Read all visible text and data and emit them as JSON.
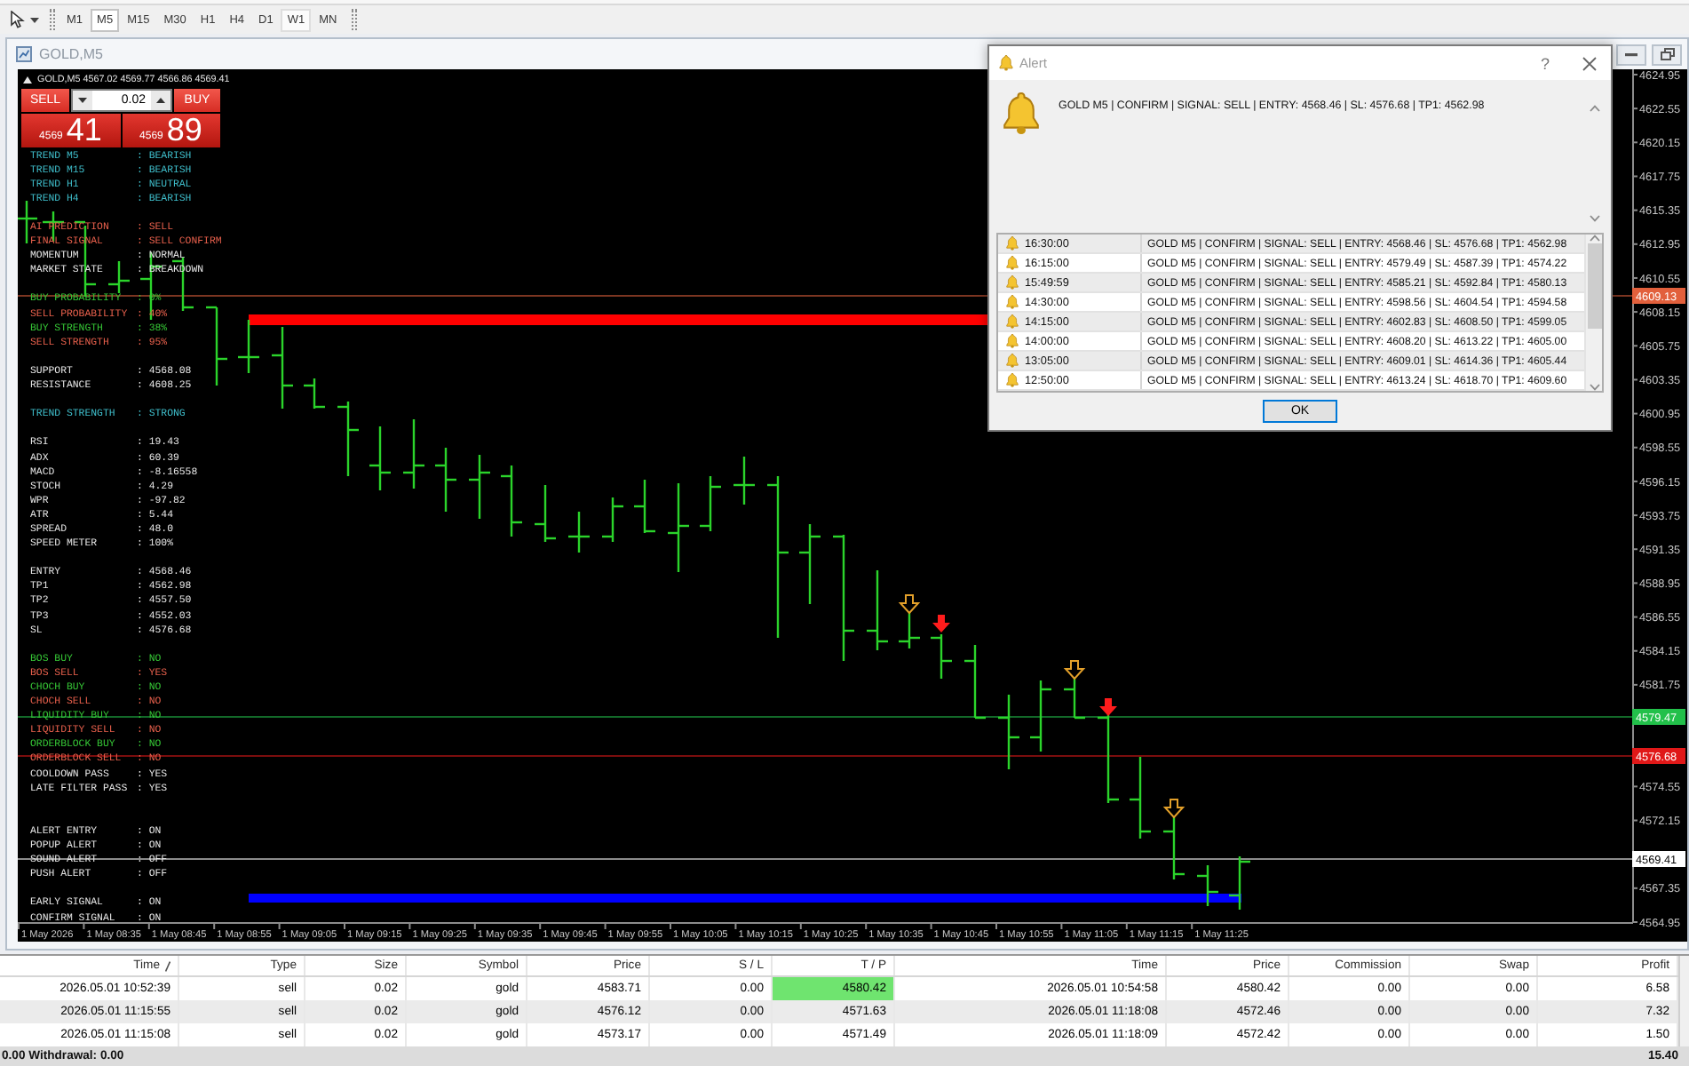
{
  "toolbar": {
    "timeframes": [
      {
        "label": "M1",
        "selected": false,
        "hovered": false
      },
      {
        "label": "M5",
        "selected": true,
        "hovered": false
      },
      {
        "label": "M15",
        "selected": false,
        "hovered": false
      },
      {
        "label": "M30",
        "selected": false,
        "hovered": false
      },
      {
        "label": "H1",
        "selected": false,
        "hovered": false
      },
      {
        "label": "H4",
        "selected": false,
        "hovered": false
      },
      {
        "label": "D1",
        "selected": false,
        "hovered": false
      },
      {
        "label": "W1",
        "selected": false,
        "hovered": true
      },
      {
        "label": "MN",
        "selected": false,
        "hovered": false
      }
    ]
  },
  "chart_window": {
    "title": "GOLD,M5"
  },
  "chart": {
    "header": "GOLD,M5 4567.02 4569.77 4566.86 4569.41",
    "trade_panel": {
      "sell": "SELL",
      "buy": "BUY",
      "lot": "0.02",
      "sell_price": {
        "prefix": "4569",
        "main": "41"
      },
      "buy_price": {
        "prefix": "4569",
        "main": "89"
      }
    },
    "info_sections": [
      {
        "rows": [
          {
            "label": "TREND M5",
            "value": ": BEARISH",
            "color": "#3fbfcc"
          },
          {
            "label": "TREND M15",
            "value": ": BEARISH",
            "color": "#3fbfcc"
          },
          {
            "label": "TREND H1",
            "value": ": NEUTRAL",
            "color": "#3fbfcc"
          },
          {
            "label": "TREND H4",
            "value": ": BEARISH",
            "color": "#3fbfcc"
          }
        ]
      },
      {
        "rows": [
          {
            "label": "AI PREDICTION",
            "value": ": SELL",
            "color": "#e8604c"
          },
          {
            "label": "FINAL SIGNAL",
            "value": ": SELL CONFIRM",
            "color": "#e8604c"
          },
          {
            "label": "MOMENTUM",
            "value": ": NORMAL",
            "color": "#e6e6e6"
          },
          {
            "label": "MARKET STATE",
            "value": ": BREAKDOWN",
            "color": "#e6e6e6"
          }
        ]
      },
      {
        "rows": [
          {
            "label": "BUY PROBABILITY",
            "value": ": 0%",
            "color": "#36c836"
          },
          {
            "label": "SELL PROBABILITY",
            "value": ": 40%",
            "color": "#e8604c"
          },
          {
            "label": "BUY STRENGTH",
            "value": ": 38%",
            "color": "#36c836"
          },
          {
            "label": "SELL STRENGTH",
            "value": ": 95%",
            "color": "#e8604c"
          }
        ]
      },
      {
        "rows": [
          {
            "label": "SUPPORT",
            "value": ": 4568.08",
            "color": "#e6e6e6"
          },
          {
            "label": "RESISTANCE",
            "value": ": 4608.25",
            "color": "#e6e6e6"
          }
        ]
      },
      {
        "rows": [
          {
            "label": "TREND STRENGTH",
            "value": ": STRONG",
            "color": "#3fbfcc"
          }
        ]
      },
      {
        "rows": [
          {
            "label": "RSI",
            "value": ": 19.43",
            "color": "#e6e6e6"
          },
          {
            "label": "ADX",
            "value": ": 60.39",
            "color": "#e6e6e6"
          },
          {
            "label": "MACD",
            "value": ": -8.16558",
            "color": "#e6e6e6"
          },
          {
            "label": "STOCH",
            "value": ": 4.29",
            "color": "#e6e6e6"
          },
          {
            "label": "WPR",
            "value": ": -97.82",
            "color": "#e6e6e6"
          },
          {
            "label": "ATR",
            "value": ": 5.44",
            "color": "#e6e6e6"
          },
          {
            "label": "SPREAD",
            "value": ": 48.0",
            "color": "#e6e6e6"
          },
          {
            "label": "SPEED METER",
            "value": ": 100%",
            "color": "#e6e6e6"
          }
        ]
      },
      {
        "rows": [
          {
            "label": "ENTRY",
            "value": ": 4568.46",
            "color": "#e6e6e6"
          },
          {
            "label": "TP1",
            "value": ": 4562.98",
            "color": "#e6e6e6"
          },
          {
            "label": "TP2",
            "value": ": 4557.50",
            "color": "#e6e6e6"
          },
          {
            "label": "TP3",
            "value": ": 4552.03",
            "color": "#e6e6e6"
          },
          {
            "label": "SL",
            "value": ": 4576.68",
            "color": "#e6e6e6"
          }
        ]
      },
      {
        "rows": [
          {
            "label": "BOS BUY",
            "value": ": NO",
            "color": "#36c836"
          },
          {
            "label": "BOS SELL",
            "value": ": YES",
            "color": "#e8604c"
          },
          {
            "label": "CHOCH BUY",
            "value": ": NO",
            "color": "#36c836"
          },
          {
            "label": "CHOCH SELL",
            "value": ": NO",
            "color": "#e8604c"
          },
          {
            "label": "LIQUIDITY BUY",
            "value": ": NO",
            "color": "#36c836"
          },
          {
            "label": "LIQUIDITY SELL",
            "value": ": NO",
            "color": "#e8604c"
          },
          {
            "label": "ORDERBLOCK BUY",
            "value": ": NO",
            "color": "#36c836"
          },
          {
            "label": "ORDERBLOCK SELL",
            "value": ": NO",
            "color": "#e8604c"
          },
          {
            "label": "COOLDOWN PASS",
            "value": ": YES",
            "color": "#e6e6e6"
          },
          {
            "label": "LATE FILTER PASS",
            "value": ": YES",
            "color": "#e6e6e6"
          }
        ]
      },
      {
        "rows": [
          {
            "label": "ALERT ENTRY",
            "value": ": ON",
            "color": "#e6e6e6"
          },
          {
            "label": "POPUP ALERT",
            "value": ": ON",
            "color": "#e6e6e6"
          },
          {
            "label": "SOUND ALERT",
            "value": ": OFF",
            "color": "#e6e6e6"
          },
          {
            "label": "PUSH ALERT",
            "value": ": OFF",
            "color": "#e6e6e6"
          }
        ]
      },
      {
        "rows": [
          {
            "label": "EARLY SIGNAL",
            "value": ": ON",
            "color": "#e6e6e6"
          },
          {
            "label": "CONFIRM SIGNAL",
            "value": ": ON",
            "color": "#e6e6e6"
          }
        ]
      }
    ],
    "price_axis": [
      "4624.95",
      "4622.55",
      "4620.15",
      "4617.75",
      "4615.35",
      "4612.95",
      "4610.55",
      "4608.15",
      "4605.75",
      "4603.35",
      "4600.95",
      "4598.55",
      "4596.15",
      "4593.75",
      "4591.35",
      "4588.95",
      "4586.55",
      "4584.15",
      "4581.75",
      "4574.55",
      "4572.15",
      "4567.35",
      "4564.95"
    ],
    "price_badges": [
      {
        "text": "4609.13",
        "color": "#e2603c"
      },
      {
        "text": "4579.47",
        "color": "#22c04a"
      },
      {
        "text": "4576.68",
        "color": "#e01818"
      },
      {
        "text": "4569.41",
        "color": "#ffffff"
      }
    ],
    "time_axis": [
      "1 May 2026",
      "1 May 08:35",
      "1 May 08:45",
      "1 May 08:55",
      "1 May 09:05",
      "1 May 09:15",
      "1 May 09:25",
      "1 May 09:35",
      "1 May 09:45",
      "1 May 09:55",
      "1 May 10:05",
      "1 May 10:15",
      "1 May 10:25",
      "1 May 10:35",
      "1 May 10:45",
      "1 May 10:55",
      "1 May 11:05",
      "1 May 11:15",
      "1 May 11:25"
    ]
  },
  "alert_dialog": {
    "title": "Alert",
    "help": "?",
    "message": "GOLD M5 | CONFIRM | SIGNAL: SELL | ENTRY: 4568.46 | SL: 4576.68 | TP1: 4562.98",
    "history": [
      {
        "time": "16:30:00",
        "message": "GOLD M5 | CONFIRM | SIGNAL: SELL | ENTRY: 4568.46 | SL: 4576.68 | TP1: 4562.98"
      },
      {
        "time": "16:15:00",
        "message": "GOLD M5 | CONFIRM | SIGNAL: SELL | ENTRY: 4579.49 | SL: 4587.39 | TP1: 4574.22"
      },
      {
        "time": "15:49:59",
        "message": "GOLD M5 | CONFIRM | SIGNAL: SELL | ENTRY: 4585.21 | SL: 4592.84 | TP1: 4580.13"
      },
      {
        "time": "14:30:00",
        "message": "GOLD M5 | CONFIRM | SIGNAL: SELL | ENTRY: 4598.56 | SL: 4604.54 | TP1: 4594.58"
      },
      {
        "time": "14:15:00",
        "message": "GOLD M5 | CONFIRM | SIGNAL: SELL | ENTRY: 4602.83 | SL: 4608.50 | TP1: 4599.05"
      },
      {
        "time": "14:00:00",
        "message": "GOLD M5 | CONFIRM | SIGNAL: SELL | ENTRY: 4608.20 | SL: 4613.22 | TP1: 4605.00"
      },
      {
        "time": "13:05:00",
        "message": "GOLD M5 | CONFIRM | SIGNAL: SELL | ENTRY: 4609.01 | SL: 4614.36 | TP1: 4605.44"
      },
      {
        "time": "12:50:00",
        "message": "GOLD M5 | CONFIRM | SIGNAL: SELL | ENTRY: 4613.24 | SL: 4618.70 | TP1: 4609.60"
      }
    ],
    "ok": "OK"
  },
  "terminal": {
    "columns": [
      {
        "label": "Time",
        "sorted": true
      },
      {
        "label": "Type",
        "sorted": false
      },
      {
        "label": "Size",
        "sorted": false
      },
      {
        "label": "Symbol",
        "sorted": false
      },
      {
        "label": "Price",
        "sorted": false
      },
      {
        "label": "S / L",
        "sorted": false
      },
      {
        "label": "T / P",
        "sorted": false
      },
      {
        "label": "Time",
        "sorted": false
      },
      {
        "label": "Price",
        "sorted": false
      },
      {
        "label": "Commission",
        "sorted": false
      },
      {
        "label": "Swap",
        "sorted": false
      },
      {
        "label": "Profit",
        "sorted": false
      }
    ],
    "rows": [
      {
        "cells": [
          "2026.05.01 10:52:39",
          "sell",
          "0.02",
          "gold",
          "4583.71",
          "0.00",
          "4580.42",
          "2026.05.01 10:54:58",
          "4580.42",
          "0.00",
          "0.00",
          "6.58"
        ],
        "tp_highlighted": true
      },
      {
        "cells": [
          "2026.05.01 11:15:55",
          "sell",
          "0.02",
          "gold",
          "4576.12",
          "0.00",
          "4571.63",
          "2026.05.01 11:18:08",
          "4572.46",
          "0.00",
          "0.00",
          "7.32"
        ],
        "tp_highlighted": false
      },
      {
        "cells": [
          "2026.05.01 11:15:08",
          "sell",
          "0.02",
          "gold",
          "4573.17",
          "0.00",
          "4571.49",
          "2026.05.01 11:18:09",
          "4572.42",
          "0.00",
          "0.00",
          "1.50"
        ],
        "tp_highlighted": false
      }
    ],
    "footer": {
      "summary": "0.00 Withdrawal: 0.00",
      "total": "15.40"
    }
  }
}
